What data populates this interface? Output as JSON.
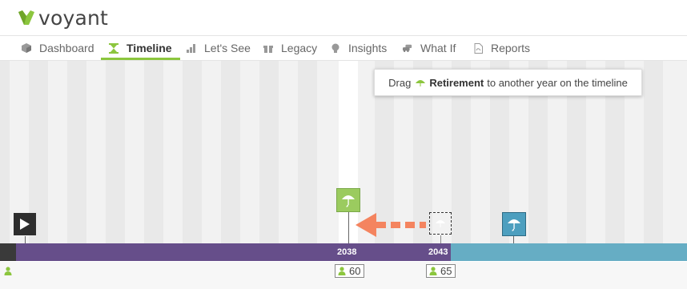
{
  "app": {
    "name": "voyant"
  },
  "nav": [
    {
      "label": "Dashboard",
      "icon": "cube-icon"
    },
    {
      "label": "Timeline",
      "icon": "hourglass-icon",
      "active": true
    },
    {
      "label": "Let's See",
      "icon": "bar-chart-icon"
    },
    {
      "label": "Legacy",
      "icon": "gift-icon"
    },
    {
      "label": "Insights",
      "icon": "lightbulb-icon"
    },
    {
      "label": "What If",
      "icon": "cars-icon"
    },
    {
      "label": "Reports",
      "icon": "pdf-icon"
    }
  ],
  "tooltip": {
    "prefix": "Drag",
    "bold": "Retirement",
    "suffix": "to another year on the timeline"
  },
  "timeline": {
    "marker_years": [
      "2038",
      "2043"
    ],
    "ages": [
      "60",
      "65"
    ],
    "colors": {
      "working": "#664e8a",
      "retired": "#66adc4",
      "start": "#3a3a3a",
      "accent": "#8cc63e",
      "arrow": "#f4845f"
    }
  }
}
